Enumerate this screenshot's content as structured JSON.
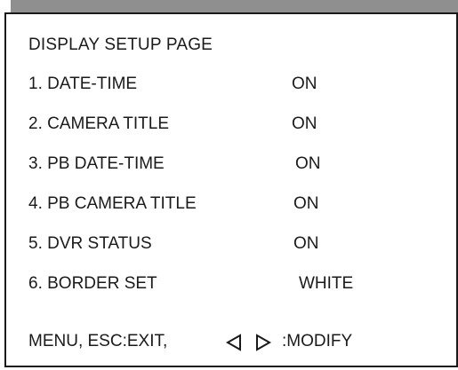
{
  "screen": {
    "title": "DISPLAY SETUP PAGE"
  },
  "menu": {
    "items": [
      {
        "label": "1. DATE-TIME",
        "value": "ON"
      },
      {
        "label": "2. CAMERA TITLE",
        "value": "ON"
      },
      {
        "label": "3. PB DATE-TIME",
        "value": "ON"
      },
      {
        "label": "4. PB CAMERA TITLE",
        "value": "ON"
      },
      {
        "label": "5. DVR STATUS",
        "value": "ON"
      },
      {
        "label": "6. BORDER SET",
        "value": "WHITE"
      }
    ]
  },
  "footer": {
    "exit_text": "MENU, ESC:EXIT,",
    "left_icon": "left-triangle-icon",
    "right_icon": "right-triangle-icon",
    "modify_text": ":MODIFY"
  },
  "colors": {
    "border": "#1a1a1a",
    "shadow": "#8f8f8f",
    "background": "#ffffff"
  }
}
